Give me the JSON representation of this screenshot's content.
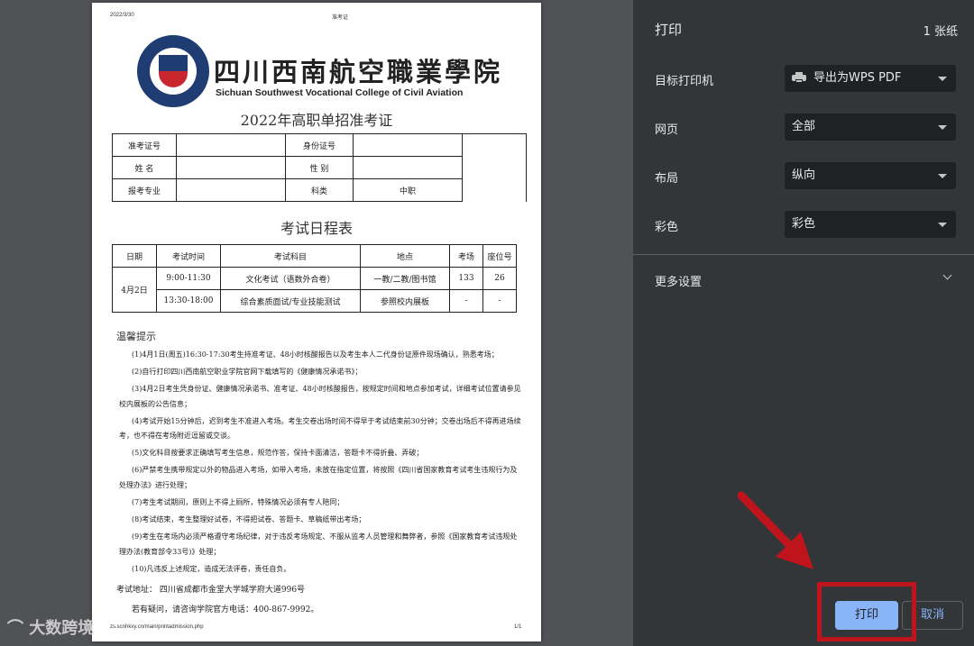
{
  "document": {
    "header_date": "2022/3/30",
    "header_title": "准考证",
    "college_name_cn": "四川西南航空職業學院",
    "college_name_en": "Sichuan Southwest Vocational College of Civil Aviation",
    "exam_title": "2022年高职单招准考证",
    "info_table": {
      "admission_no_label": "准考证号",
      "id_no_label": "身份证号",
      "name_label": "姓  名",
      "gender_label": "性  别",
      "major_label": "报考专业",
      "category_label": "科类",
      "category_value": "中职"
    },
    "schedule_title": "考试日程表",
    "schedule_headers": [
      "日期",
      "考试时间",
      "考试科目",
      "地点",
      "考场",
      "座位号"
    ],
    "schedule_date": "4月2日",
    "schedule_rows": [
      {
        "time": "9:00-11:30",
        "subject": "文化考试（语数外合卷）",
        "location": "一教/二教/图书馆",
        "room": "133",
        "seat": "26"
      },
      {
        "time": "13:30-18:00",
        "subject": "综合素质面试/专业技能测试",
        "location": "参照校内展板",
        "room": "-",
        "seat": "-"
      }
    ],
    "tips_title": "温馨提示",
    "tips": [
      "(1)4月1日(周五)16:30-17:30考生持准考证、48小时核酸报告以及考生本人二代身份证原件现场确认，熟悉考场；",
      "(2)自行打印四川西南航空职业学院官网下载填写的《健康情况承诺书》；",
      "(3)4月2日考生凭身份证、健康情况承诺书、准考证、48小时核酸报告，按规定时间和地点参加考试，详细考试位置请参见校内展板的公告信息；",
      "(4)考试开始15分钟后，迟到考生不准进入考场。考生交卷出场时间不得早于考试结束前30分钟；交卷出场后不得再进场续考，也不得在考场附近逗留或交谈。",
      "(5)文化科目按要求正确填写考生信息，规范作答，保持卡面清洁，答题卡不得折叠、弄破；",
      "(6)严禁考生携带规定以外的物品进入考场，如带入考场，未放在指定位置，将按照《四川省国家教育考试考生违规行为及处理办法》进行处理；",
      "(7)考生考试期间，原则上不得上厕所，特殊情况必须有专人陪同；",
      "(8)考试结束，考生整理好试卷，不得把试卷、答题卡、草稿纸带出考场；",
      "(9)考生在考场内必须严格遵守考场纪律，对于违反考场规定、不服从监考人员管理和舞弊者，参照《国家教育考试违规处理办法(教育部令33号)》处理；",
      "(10)凡违反上述规定，造成无法评卷，责任自负。"
    ],
    "address": "考试地址：  四川省成都市金堂大学城学府大道996号",
    "contact": "若有疑问，请咨询学院官方电话：400-867-9992。",
    "footer_url": "zs.scnhkxy.cn/main/printadmission.php",
    "footer_page": "1/1"
  },
  "print_panel": {
    "title": "打印",
    "sheet_count": "1 张纸",
    "destination_label": "目标打印机",
    "destination_value": "导出为WPS PDF",
    "pages_label": "网页",
    "pages_value": "全部",
    "layout_label": "布局",
    "layout_value": "纵向",
    "color_label": "彩色",
    "color_value": "彩色",
    "more_settings": "更多设置",
    "print_button": "打印",
    "cancel_button": "取消"
  },
  "annotation": {
    "highlight_color": "#c0141c"
  },
  "watermark": "大数跨境"
}
